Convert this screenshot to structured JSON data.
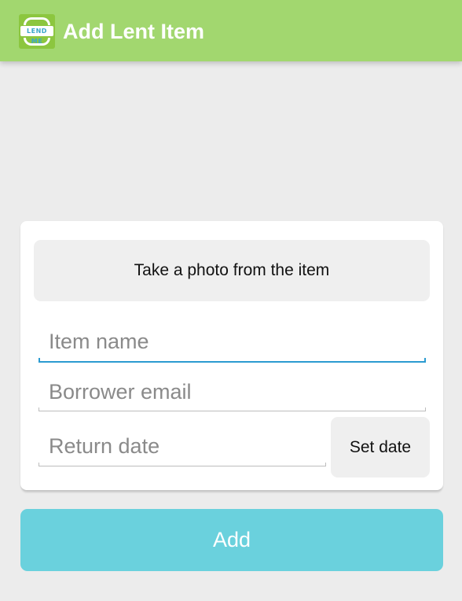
{
  "app_bar": {
    "logo_text": "LEND ME",
    "title": "Add Lent Item",
    "background_color": "#a2d76f"
  },
  "form": {
    "photo_button_label": "Take a photo from the item",
    "item_name": {
      "value": "",
      "placeholder": "Item name"
    },
    "borrower_email": {
      "value": "",
      "placeholder": "Borrower email"
    },
    "return_date": {
      "value": "",
      "placeholder": "Return date"
    },
    "set_date_button_label": "Set date",
    "focused_field_color": "#2b9bd1"
  },
  "add_button": {
    "label": "Add",
    "color": "#6ad1dd"
  }
}
